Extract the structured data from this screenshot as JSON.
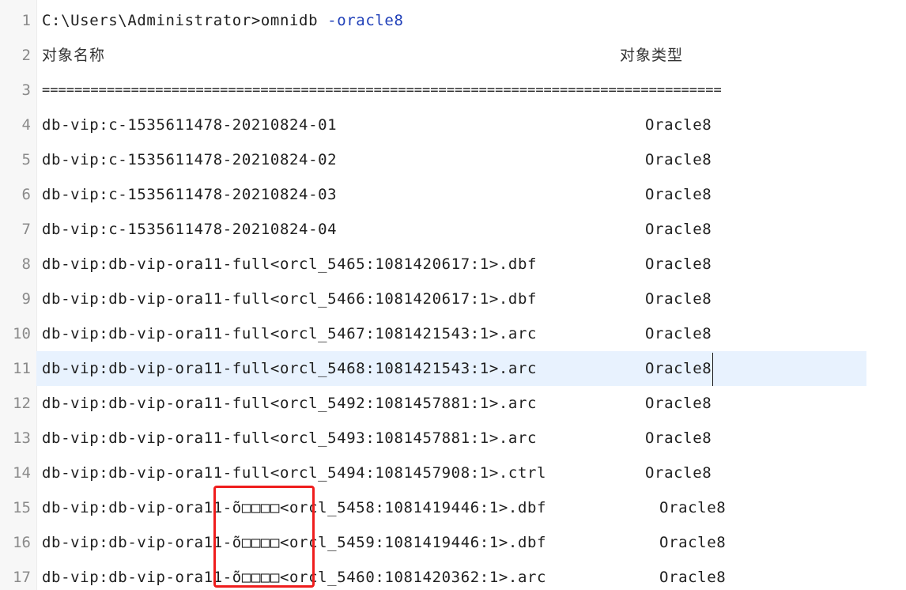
{
  "editor": {
    "active_line": 11,
    "lines": [
      {
        "num": "1",
        "name": "C:\\Users\\Administrator>omnidb ",
        "flag": "-oracle8",
        "type": ""
      },
      {
        "num": "2",
        "name": "对象名称",
        "type": "对象类型"
      },
      {
        "num": "3",
        "name": "====================================================================================",
        "type": ""
      },
      {
        "num": "4",
        "name": "db-vip:c-1535611478-20210824-01",
        "type": "Oracle8"
      },
      {
        "num": "5",
        "name": "db-vip:c-1535611478-20210824-02",
        "type": "Oracle8"
      },
      {
        "num": "6",
        "name": "db-vip:c-1535611478-20210824-03",
        "type": "Oracle8"
      },
      {
        "num": "7",
        "name": "db-vip:c-1535611478-20210824-04",
        "type": "Oracle8"
      },
      {
        "num": "8",
        "name": "db-vip:db-vip-ora11-full<orcl_5465:1081420617:1>.dbf",
        "type": "Oracle8"
      },
      {
        "num": "9",
        "name": "db-vip:db-vip-ora11-full<orcl_5466:1081420617:1>.dbf",
        "type": "Oracle8"
      },
      {
        "num": "10",
        "name": "db-vip:db-vip-ora11-full<orcl_5467:1081421543:1>.arc",
        "type": "Oracle8"
      },
      {
        "num": "11",
        "name": "db-vip:db-vip-ora11-full<orcl_5468:1081421543:1>.arc",
        "type": "Oracle8"
      },
      {
        "num": "12",
        "name": "db-vip:db-vip-ora11-full<orcl_5492:1081457881:1>.arc",
        "type": "Oracle8"
      },
      {
        "num": "13",
        "name": "db-vip:db-vip-ora11-full<orcl_5493:1081457881:1>.arc",
        "type": "Oracle8"
      },
      {
        "num": "14",
        "name": "db-vip:db-vip-ora11-full<orcl_5494:1081457908:1>.ctrl",
        "type": "Oracle8"
      },
      {
        "num": "15",
        "name": "db-vip:db-vip-ora11-õ□□□□<orcl_5458:1081419446:1>.dbf",
        "type": "Oracle8"
      },
      {
        "num": "16",
        "name": "db-vip:db-vip-ora11-õ□□□□<orcl_5459:1081419446:1>.dbf",
        "type": "Oracle8"
      },
      {
        "num": "17",
        "name": "db-vip:db-vip-ora11-õ□□□□<orcl_5460:1081420362:1>.arc",
        "type": "Oracle8"
      }
    ]
  },
  "colors": {
    "highlight_box": "#ef1d1d",
    "active_line_bg": "#e8f2fe",
    "flag_text": "#1f3fb8"
  }
}
